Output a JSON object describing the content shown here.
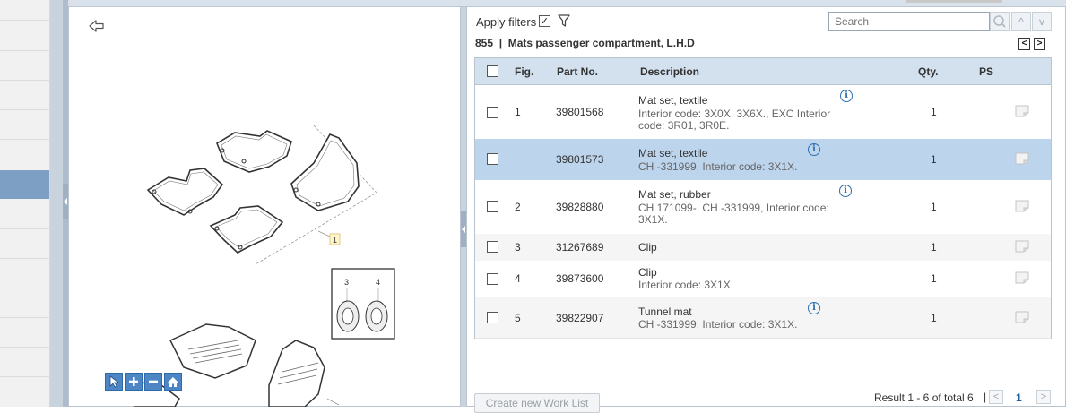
{
  "filters": {
    "label": "Apply filters",
    "checked": "✓"
  },
  "search": {
    "placeholder": "Search"
  },
  "nav": {
    "up": "^",
    "down": "v",
    "prev": "<",
    "next": ">"
  },
  "group": {
    "title": "855  |  Mats passenger compartment, L.H.D"
  },
  "table": {
    "headers": {
      "fig": "Fig.",
      "part_no": "Part No.",
      "description": "Description",
      "qty": "Qty.",
      "ps": "PS"
    },
    "rows": [
      {
        "fig": "1",
        "part_no": "39801568",
        "desc": "Mat set, textile",
        "sub1": "Interior code: 3X0X, 3X6X., EXC Interior",
        "sub2": "code: 3R01, 3R0E.",
        "qty": "1"
      },
      {
        "fig": "",
        "part_no": "39801573",
        "desc": "Mat set, textile",
        "sub1": "CH -331999, Interior code: 3X1X.",
        "sub2": "",
        "qty": "1"
      },
      {
        "fig": "2",
        "part_no": "39828880",
        "desc": "Mat set, rubber",
        "sub1": "CH 171099-, CH -331999, Interior code:",
        "sub2": "3X1X.",
        "qty": "1"
      },
      {
        "fig": "3",
        "part_no": "31267689",
        "desc": "Clip",
        "sub1": "",
        "sub2": "",
        "qty": "1"
      },
      {
        "fig": "4",
        "part_no": "39873600",
        "desc": "Clip",
        "sub1": "Interior code: 3X1X.",
        "sub2": "",
        "qty": "1"
      },
      {
        "fig": "5",
        "part_no": "39822907",
        "desc": "Tunnel mat",
        "sub1": "CH -331999, Interior code: 3X1X.",
        "sub2": "",
        "qty": "1"
      }
    ]
  },
  "illustration": {
    "callouts": {
      "c1": "1",
      "c3": "3",
      "c4": "4"
    }
  },
  "footer": {
    "worklist_label": "Create new Work List",
    "result": "Result 1 - 6 of total 6",
    "separator": "|",
    "page": "1",
    "prev": "<",
    "next": ">"
  },
  "colors": {
    "header_bg": "#d3e0ee",
    "selected_row": "#bcd4ec",
    "accent": "#2f6fae",
    "tool_blue": "#4e86c5"
  }
}
